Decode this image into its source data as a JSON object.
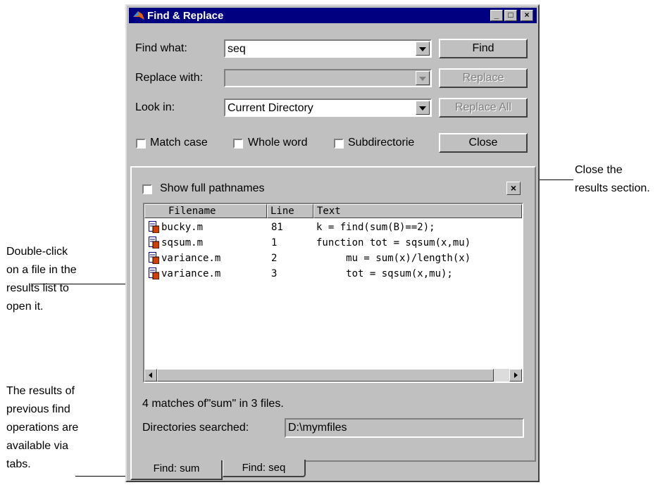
{
  "window": {
    "title": "Find & Replace",
    "buttons": {
      "minimize": "_",
      "maximize": "□",
      "close": "×"
    }
  },
  "form": {
    "find_label": "Find what:",
    "find_value": "seq",
    "replace_label": "Replace with:",
    "replace_value": "",
    "lookin_label": "Look in:",
    "lookin_value": "Current Directory",
    "find_button": "Find",
    "replace_button": "Replace",
    "replace_all_button": "Replace All",
    "close_button": "Close",
    "match_case": "Match case",
    "whole_word": "Whole word",
    "subdirectories": "Subdirectorie"
  },
  "results": {
    "show_full_pathnames": "Show full pathnames",
    "close_results": "×",
    "columns": [
      "Filename",
      "Line",
      "Text"
    ],
    "rows": [
      {
        "file": "bucky.m",
        "line": "81",
        "text": "k = find(sum(B)==2);"
      },
      {
        "file": "sqsum.m",
        "line": "1",
        "text": "function tot = sqsum(x,mu)"
      },
      {
        "file": "variance.m",
        "line": "2",
        "text": "     mu = sum(x)/length(x)"
      },
      {
        "file": "variance.m",
        "line": "3",
        "text": "     tot = sqsum(x,mu);"
      }
    ],
    "status": "4 matches of\"sum\" in 3 files.",
    "dirs_label": "Directories searched:",
    "dirs_value": "D:\\mymfiles"
  },
  "tabs": [
    "Find: sum",
    "Find: seq"
  ],
  "annotations": {
    "close_results": [
      "Close the",
      "results section."
    ],
    "double_click": [
      "Double-click",
      "on a file in the",
      "results list to",
      "open it."
    ],
    "tabs_note": [
      "The results of",
      "previous find",
      "operations are",
      "available via",
      "tabs."
    ]
  }
}
